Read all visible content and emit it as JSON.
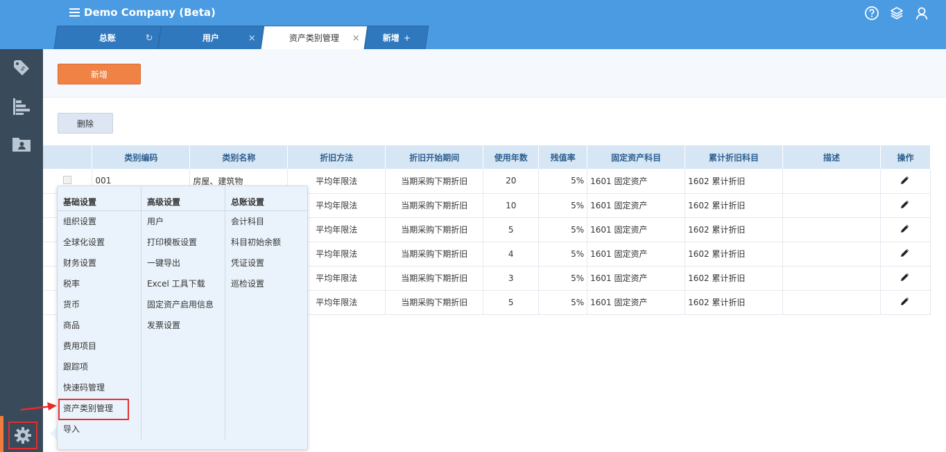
{
  "app": {
    "title": "Demo Company (Beta)"
  },
  "tabs": [
    {
      "label": "总账",
      "trail_icon": "refresh-icon"
    },
    {
      "label": "用户",
      "trail_icon": "close-icon"
    },
    {
      "label": "资产类别管理",
      "trail_icon": "close-icon",
      "active": true
    },
    {
      "label": "新增",
      "trail_icon": "plus-icon"
    }
  ],
  "tab_close_glyph": "×",
  "tab_plus_glyph": "+",
  "tab_refresh_glyph": "↻",
  "toolbar": {
    "add_label": "新增",
    "delete_label": "删除"
  },
  "table": {
    "headers": [
      "类别编码",
      "类别名称",
      "折旧方法",
      "折旧开始期间",
      "使用年数",
      "残值率",
      "固定资产科目",
      "累计折旧科目",
      "描述",
      "操作"
    ],
    "rows": [
      {
        "code": "001",
        "name": "房屋、建筑物",
        "method": "平均年限法",
        "start": "当期采购下期折旧",
        "years": "20",
        "residual": "5%",
        "asset_account": "1601 固定资产",
        "dep_account": "1602 累计折旧",
        "desc": ""
      },
      {
        "code": "",
        "name": "",
        "method": "平均年限法",
        "start": "当期采购下期折旧",
        "years": "10",
        "residual": "5%",
        "asset_account": "1601 固定资产",
        "dep_account": "1602 累计折旧",
        "desc": ""
      },
      {
        "code": "",
        "name": "",
        "method": "平均年限法",
        "start": "当期采购下期折旧",
        "years": "5",
        "residual": "5%",
        "asset_account": "1601 固定资产",
        "dep_account": "1602 累计折旧",
        "desc": ""
      },
      {
        "code": "",
        "name": "",
        "method": "平均年限法",
        "start": "当期采购下期折旧",
        "years": "4",
        "residual": "5%",
        "asset_account": "1601 固定资产",
        "dep_account": "1602 累计折旧",
        "desc": ""
      },
      {
        "code": "",
        "name": "",
        "method": "平均年限法",
        "start": "当期采购下期折旧",
        "years": "3",
        "residual": "5%",
        "asset_account": "1601 固定资产",
        "dep_account": "1602 累计折旧",
        "desc": ""
      },
      {
        "code": "",
        "name": "",
        "method": "平均年限法",
        "start": "当期采购下期折旧",
        "years": "5",
        "residual": "5%",
        "asset_account": "1601 固定资产",
        "dep_account": "1602 累计折旧",
        "desc": ""
      }
    ]
  },
  "settings_menu": {
    "columns": [
      {
        "title": "基础设置",
        "items": [
          "组织设置",
          "全球化设置",
          "财务设置",
          "税率",
          "货币",
          "商品",
          "费用项目",
          "跟踪项",
          "快速码管理",
          "资产类别管理",
          "导入"
        ]
      },
      {
        "title": "高级设置",
        "items": [
          "用户",
          "打印模板设置",
          "一键导出",
          "Excel 工具下载",
          "固定资产启用信息",
          "发票设置"
        ]
      },
      {
        "title": "总账设置",
        "items": [
          "会计科目",
          "科目初始余额",
          "凭证设置",
          "巡检设置"
        ]
      }
    ],
    "highlighted_item": "资产类别管理"
  },
  "colors": {
    "header_blue": "#4a9be2",
    "sidebar": "#394a5b",
    "accent_orange": "#ef8244",
    "highlight_red": "#e82c2c"
  },
  "icons": {
    "top": [
      "help-icon",
      "layers-icon",
      "user-icon"
    ],
    "sidebar": [
      "price-tag-icon",
      "bar-chart-icon",
      "folder-user-icon",
      "gear-icon"
    ]
  }
}
